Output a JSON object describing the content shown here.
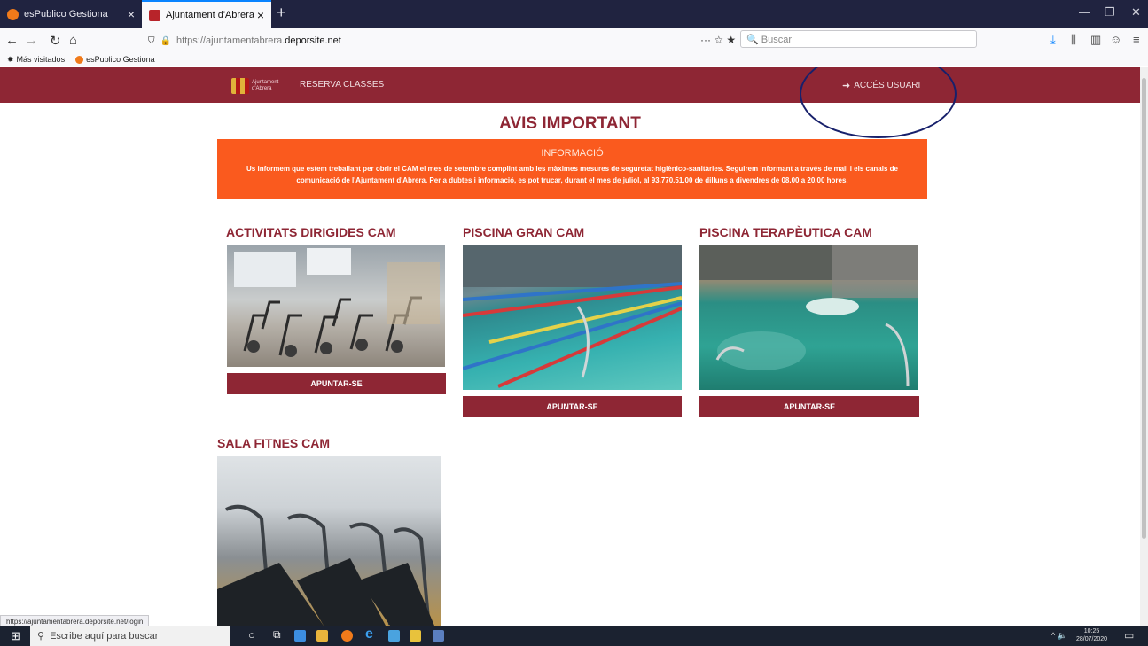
{
  "browser": {
    "tabs": [
      {
        "title": "esPublico Gestiona",
        "active": false
      },
      {
        "title": "Ajuntament d'Abrera - Deporsi",
        "active": true
      }
    ],
    "url_prefix": "https://ajuntamentabrera.",
    "url_domain": "deporsite.net",
    "search_placeholder": "Buscar",
    "bookmarks": [
      "Más visitados",
      "esPublico Gestiona"
    ],
    "status_url": "https://ajuntamentabrera.deporsite.net/login"
  },
  "site": {
    "logo_line1": "Ajuntament",
    "logo_line2": "d'Abrera",
    "menu_reserva": "RESERVA CLASSES",
    "menu_acces": "ACCÉS USUARI",
    "avis_title": "AVIS IMPORTANT",
    "info_heading": "INFORMACIÓ",
    "info_body": "Us informem que estem treballant per obrir el CAM el mes de setembre complint amb les màximes mesures de seguretat higiènico-sanitàries. Seguirem informant a través de mail i els canals de comunicació de l'Ajuntament d'Abrera. Per a dubtes i informació, es pot trucar, durant el mes de juliol, al 93.770.51.00 de dilluns a divendres de 08.00 a 20.00 hores.",
    "cards": [
      {
        "title": "ACTIVITATS DIRIGIDES CAM",
        "button": "APUNTAR-SE"
      },
      {
        "title": "PISCINA GRAN CAM",
        "button": "APUNTAR-SE"
      },
      {
        "title": "PISCINA TERAPÈUTICA CAM",
        "button": "APUNTAR-SE"
      },
      {
        "title": "SALA FITNES CAM",
        "button": ""
      }
    ],
    "accent_color": "#8e2634",
    "info_color": "#fa5a1e"
  },
  "taskbar": {
    "search_placeholder": "Escribe aquí para buscar",
    "time": "10:25",
    "date": "28/07/2020"
  }
}
